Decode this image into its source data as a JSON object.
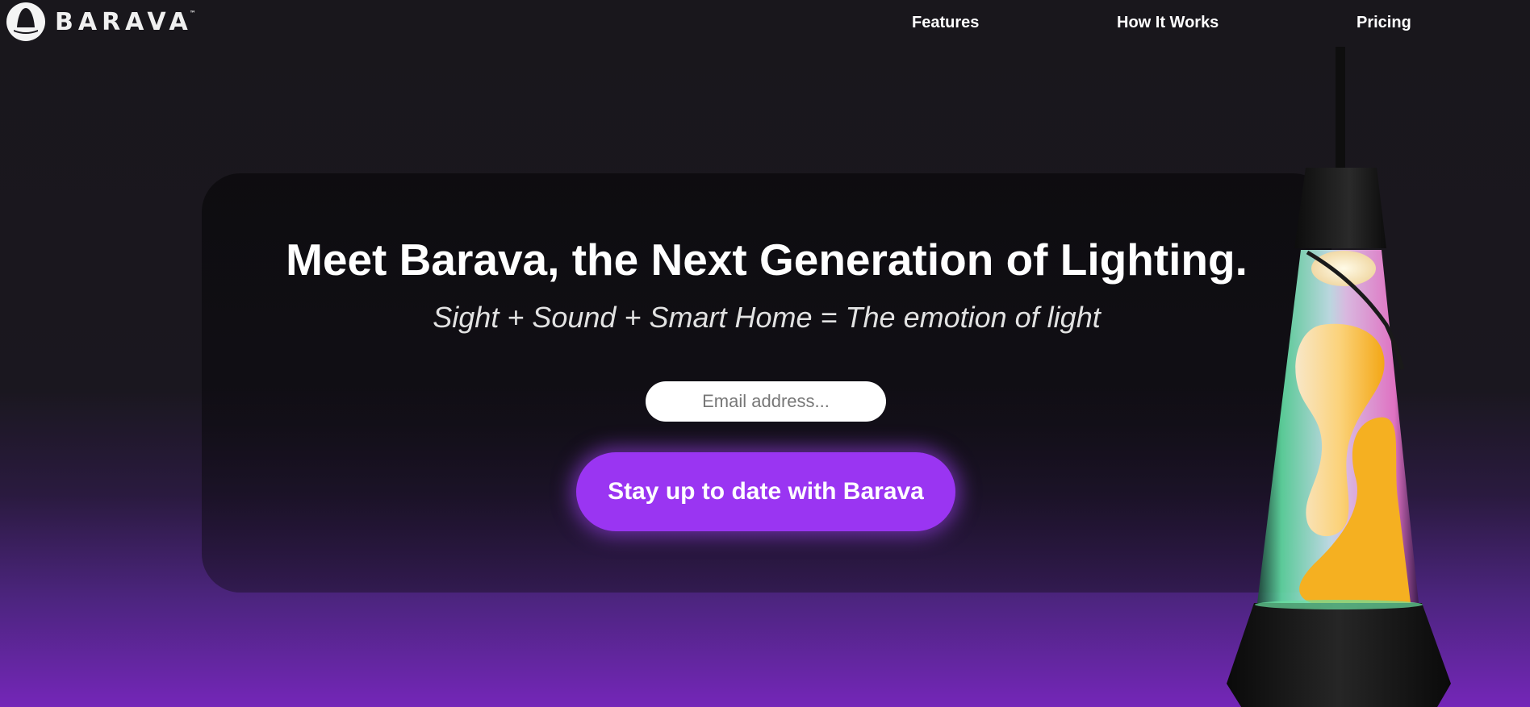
{
  "brand": {
    "name": "BARAVA",
    "trademark": "™"
  },
  "nav": {
    "features": "Features",
    "how_it_works": "How It Works",
    "pricing": "Pricing"
  },
  "hero": {
    "title": "Meet Barava, the Next Generation of Lighting.",
    "subtitle": "Sight + Sound + Smart Home = The emotion of light",
    "email_placeholder": "Email address...",
    "cta_label": "Stay up to date with Barava"
  },
  "colors": {
    "background": "#19171c",
    "accent_purple": "#9a35f2",
    "bottom_gradient": "#7426b8",
    "lava_yellow": "#f6b21f"
  },
  "icons": {
    "logo": "barava-logo-icon",
    "product": "lava-lamp-image"
  }
}
